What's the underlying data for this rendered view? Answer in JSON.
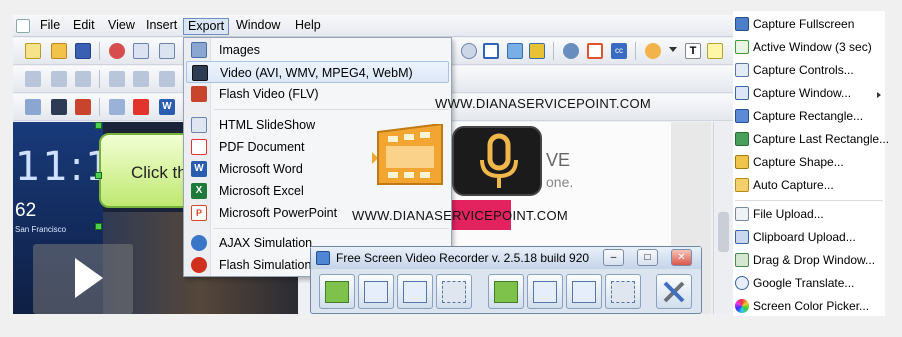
{
  "menubar": {
    "items": [
      "File",
      "Edit",
      "View",
      "Insert",
      "Export",
      "Window",
      "Help"
    ],
    "active": "Export"
  },
  "export_menu": {
    "items": [
      {
        "label": "Images",
        "icon": "images-icon"
      },
      {
        "label": "Video (AVI, WMV, MPEG4, WebM)",
        "icon": "film-icon"
      },
      {
        "label": "Flash Video (FLV)",
        "icon": "flash-video-icon"
      },
      {
        "label": "HTML SlideShow",
        "icon": "html-slideshow-icon"
      },
      {
        "label": "PDF Document",
        "icon": "pdf-icon"
      },
      {
        "label": "Microsoft Word",
        "icon": "word-icon"
      },
      {
        "label": "Microsoft Excel",
        "icon": "excel-icon"
      },
      {
        "label": "Microsoft PowerPoint",
        "icon": "powerpoint-icon"
      },
      {
        "label": "AJAX Simulation",
        "icon": "ajax-icon"
      },
      {
        "label": "Flash Simulation",
        "icon": "flash-simulation-icon"
      }
    ],
    "highlighted": "Video (AVI, WMV, MPEG4, WebM)"
  },
  "watermark": "WWW.DIANASERVICEPOINT.COM",
  "canvas": {
    "clock": "11:1",
    "temperature": "62",
    "city": "San Francisco",
    "callout_text": "Click th"
  },
  "captured_page": {
    "text1": "VE",
    "text2": "one."
  },
  "recorder": {
    "title": "Free Screen Video Recorder  v. 2.5.18 build 920",
    "window_buttons": [
      "–",
      "□",
      "✕"
    ],
    "buttons": [
      "record-fullscreen",
      "record-window",
      "record-region",
      "record-free",
      "screenshot-fullscreen",
      "screenshot-window",
      "screenshot-region",
      "screenshot-free",
      "settings"
    ]
  },
  "capture_menu": {
    "items": [
      {
        "label": "Capture Fullscreen",
        "icon": "monitor-icon"
      },
      {
        "label": "Active Window (3 sec)",
        "icon": "active-window-icon"
      },
      {
        "label": "Capture Controls...",
        "icon": "controls-icon"
      },
      {
        "label": "Capture Window...",
        "icon": "window-icon",
        "submenu": true
      },
      {
        "label": "Capture Rectangle...",
        "icon": "rectangle-icon"
      },
      {
        "label": "Capture Last Rectangle...",
        "icon": "last-rectangle-icon"
      },
      {
        "label": "Capture Shape...",
        "icon": "shape-icon"
      },
      {
        "label": "Auto Capture...",
        "icon": "auto-capture-icon"
      },
      {
        "label": "File Upload...",
        "icon": "file-upload-icon"
      },
      {
        "label": "Clipboard Upload...",
        "icon": "clipboard-icon"
      },
      {
        "label": "Drag & Drop Window...",
        "icon": "drag-drop-icon"
      },
      {
        "label": "Google Translate...",
        "icon": "translate-icon"
      },
      {
        "label": "Screen Color Picker...",
        "icon": "color-picker-icon"
      }
    ]
  },
  "colors": {
    "accent": "#dbe6f5",
    "highlight": "#dce8f8",
    "callout": "#bfe870",
    "mic_bg": "#1b1b1b",
    "mic": "#f0b84a",
    "film": "#f2a530"
  }
}
